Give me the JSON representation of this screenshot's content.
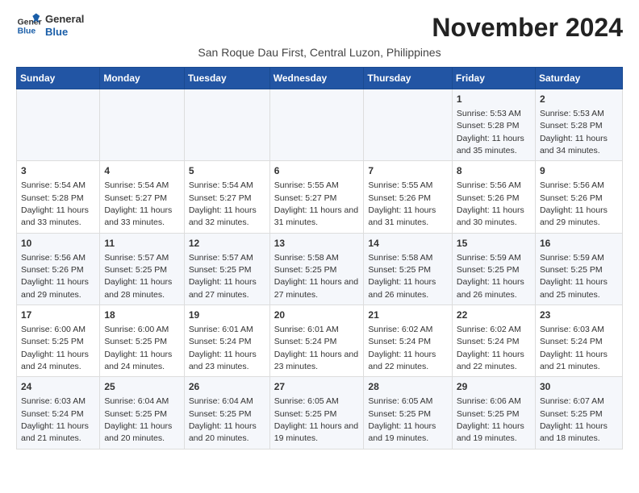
{
  "header": {
    "logo_line1": "General",
    "logo_line2": "Blue",
    "title": "November 2024",
    "subtitle": "San Roque Dau First, Central Luzon, Philippines"
  },
  "columns": [
    "Sunday",
    "Monday",
    "Tuesday",
    "Wednesday",
    "Thursday",
    "Friday",
    "Saturday"
  ],
  "rows": [
    [
      {
        "day": "",
        "info": ""
      },
      {
        "day": "",
        "info": ""
      },
      {
        "day": "",
        "info": ""
      },
      {
        "day": "",
        "info": ""
      },
      {
        "day": "",
        "info": ""
      },
      {
        "day": "1",
        "info": "Sunrise: 5:53 AM\nSunset: 5:28 PM\nDaylight: 11 hours and 35 minutes."
      },
      {
        "day": "2",
        "info": "Sunrise: 5:53 AM\nSunset: 5:28 PM\nDaylight: 11 hours and 34 minutes."
      }
    ],
    [
      {
        "day": "3",
        "info": "Sunrise: 5:54 AM\nSunset: 5:28 PM\nDaylight: 11 hours and 33 minutes."
      },
      {
        "day": "4",
        "info": "Sunrise: 5:54 AM\nSunset: 5:27 PM\nDaylight: 11 hours and 33 minutes."
      },
      {
        "day": "5",
        "info": "Sunrise: 5:54 AM\nSunset: 5:27 PM\nDaylight: 11 hours and 32 minutes."
      },
      {
        "day": "6",
        "info": "Sunrise: 5:55 AM\nSunset: 5:27 PM\nDaylight: 11 hours and 31 minutes."
      },
      {
        "day": "7",
        "info": "Sunrise: 5:55 AM\nSunset: 5:26 PM\nDaylight: 11 hours and 31 minutes."
      },
      {
        "day": "8",
        "info": "Sunrise: 5:56 AM\nSunset: 5:26 PM\nDaylight: 11 hours and 30 minutes."
      },
      {
        "day": "9",
        "info": "Sunrise: 5:56 AM\nSunset: 5:26 PM\nDaylight: 11 hours and 29 minutes."
      }
    ],
    [
      {
        "day": "10",
        "info": "Sunrise: 5:56 AM\nSunset: 5:26 PM\nDaylight: 11 hours and 29 minutes."
      },
      {
        "day": "11",
        "info": "Sunrise: 5:57 AM\nSunset: 5:25 PM\nDaylight: 11 hours and 28 minutes."
      },
      {
        "day": "12",
        "info": "Sunrise: 5:57 AM\nSunset: 5:25 PM\nDaylight: 11 hours and 27 minutes."
      },
      {
        "day": "13",
        "info": "Sunrise: 5:58 AM\nSunset: 5:25 PM\nDaylight: 11 hours and 27 minutes."
      },
      {
        "day": "14",
        "info": "Sunrise: 5:58 AM\nSunset: 5:25 PM\nDaylight: 11 hours and 26 minutes."
      },
      {
        "day": "15",
        "info": "Sunrise: 5:59 AM\nSunset: 5:25 PM\nDaylight: 11 hours and 26 minutes."
      },
      {
        "day": "16",
        "info": "Sunrise: 5:59 AM\nSunset: 5:25 PM\nDaylight: 11 hours and 25 minutes."
      }
    ],
    [
      {
        "day": "17",
        "info": "Sunrise: 6:00 AM\nSunset: 5:25 PM\nDaylight: 11 hours and 24 minutes."
      },
      {
        "day": "18",
        "info": "Sunrise: 6:00 AM\nSunset: 5:25 PM\nDaylight: 11 hours and 24 minutes."
      },
      {
        "day": "19",
        "info": "Sunrise: 6:01 AM\nSunset: 5:24 PM\nDaylight: 11 hours and 23 minutes."
      },
      {
        "day": "20",
        "info": "Sunrise: 6:01 AM\nSunset: 5:24 PM\nDaylight: 11 hours and 23 minutes."
      },
      {
        "day": "21",
        "info": "Sunrise: 6:02 AM\nSunset: 5:24 PM\nDaylight: 11 hours and 22 minutes."
      },
      {
        "day": "22",
        "info": "Sunrise: 6:02 AM\nSunset: 5:24 PM\nDaylight: 11 hours and 22 minutes."
      },
      {
        "day": "23",
        "info": "Sunrise: 6:03 AM\nSunset: 5:24 PM\nDaylight: 11 hours and 21 minutes."
      }
    ],
    [
      {
        "day": "24",
        "info": "Sunrise: 6:03 AM\nSunset: 5:24 PM\nDaylight: 11 hours and 21 minutes."
      },
      {
        "day": "25",
        "info": "Sunrise: 6:04 AM\nSunset: 5:25 PM\nDaylight: 11 hours and 20 minutes."
      },
      {
        "day": "26",
        "info": "Sunrise: 6:04 AM\nSunset: 5:25 PM\nDaylight: 11 hours and 20 minutes."
      },
      {
        "day": "27",
        "info": "Sunrise: 6:05 AM\nSunset: 5:25 PM\nDaylight: 11 hours and 19 minutes."
      },
      {
        "day": "28",
        "info": "Sunrise: 6:05 AM\nSunset: 5:25 PM\nDaylight: 11 hours and 19 minutes."
      },
      {
        "day": "29",
        "info": "Sunrise: 6:06 AM\nSunset: 5:25 PM\nDaylight: 11 hours and 19 minutes."
      },
      {
        "day": "30",
        "info": "Sunrise: 6:07 AM\nSunset: 5:25 PM\nDaylight: 11 hours and 18 minutes."
      }
    ]
  ]
}
